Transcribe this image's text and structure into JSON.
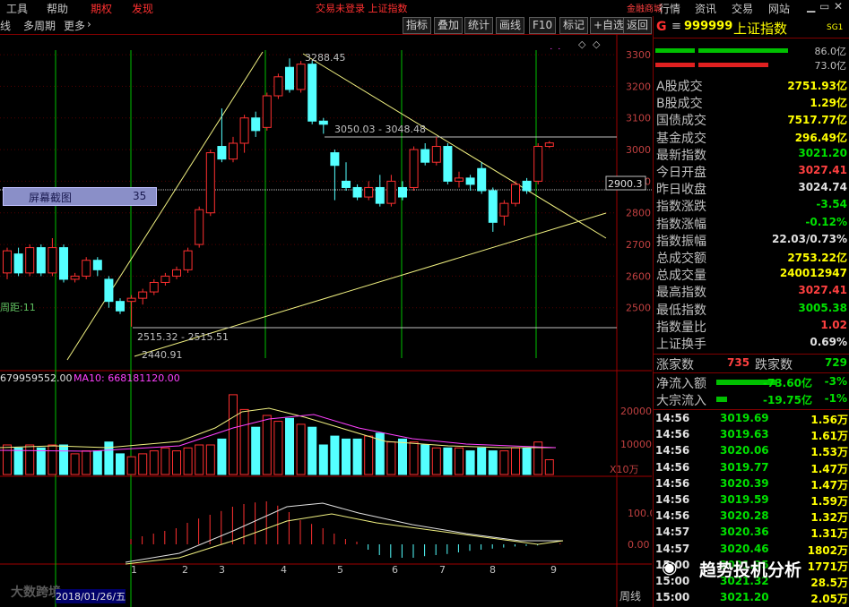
{
  "menu": {
    "tools": "工具",
    "help": "帮助",
    "futures": "期权",
    "publish": "发现",
    "status": "交易未登录  上证指数",
    "quote": "行情",
    "info": "资讯",
    "trade": "交易",
    "website": "网站",
    "finance_mall": "金融商城"
  },
  "toolbar": {
    "kline": "线",
    "multi_period": "多周期",
    "more": "更多",
    "indicator": "指标",
    "overlay": "叠加",
    "stats": "统计",
    "draw": "画线",
    "f10": "F10",
    "mark": "标记",
    "add_watch": "+自选",
    "back": "返回"
  },
  "stock": {
    "prefix": "G",
    "code": "999999",
    "name": "上证指数",
    "tag": "SG1",
    "bar1": "86.0亿",
    "bar2": "73.0亿"
  },
  "summary": [
    {
      "k": "A股成交",
      "v": "2751.93亿",
      "c": "#ffff00"
    },
    {
      "k": "B股成交",
      "v": "1.29亿",
      "c": "#ffff00"
    },
    {
      "k": "国债成交",
      "v": "7517.77亿",
      "c": "#ffff00"
    },
    {
      "k": "基金成交",
      "v": "296.49亿",
      "c": "#ffff00"
    },
    {
      "k": "最新指数",
      "v": "3021.20",
      "c": "#00e000"
    },
    {
      "k": "今日开盘",
      "v": "3027.41",
      "c": "#ff4040"
    },
    {
      "k": "昨日收盘",
      "v": "3024.74",
      "c": "#e0e0e0"
    },
    {
      "k": "指数涨跌",
      "v": "-3.54",
      "c": "#00e000"
    },
    {
      "k": "指数涨幅",
      "v": "-0.12%",
      "c": "#00e000"
    },
    {
      "k": "指数振幅",
      "v": "22.03/0.73%",
      "c": "#e0e0e0"
    },
    {
      "k": "总成交额",
      "v": "2753.22亿",
      "c": "#ffff00"
    },
    {
      "k": "总成交量",
      "v": "240012947",
      "c": "#ffff00"
    },
    {
      "k": "最高指数",
      "v": "3027.41",
      "c": "#ff4040"
    },
    {
      "k": "最低指数",
      "v": "3005.38",
      "c": "#00e000"
    },
    {
      "k": "指数量比",
      "v": "1.02",
      "c": "#ff4040"
    },
    {
      "k": "上证换手",
      "v": "0.69%",
      "c": "#e0e0e0"
    }
  ],
  "updown": {
    "up_label": "涨家数",
    "up": "735",
    "down_label": "跌家数",
    "down": "729"
  },
  "flows": [
    {
      "k": "净流入额",
      "v": "-73.60亿",
      "pct": "-3%"
    },
    {
      "k": "大宗流入",
      "v": "-19.75亿",
      "pct": "-1%"
    }
  ],
  "ticks": [
    {
      "t": "14:56",
      "p": "3019.69",
      "q": "1.56万"
    },
    {
      "t": "14:56",
      "p": "3019.63",
      "q": "1.61万"
    },
    {
      "t": "14:56",
      "p": "3020.06",
      "q": "1.53万"
    },
    {
      "t": "14:56",
      "p": "3019.77",
      "q": "1.47万"
    },
    {
      "t": "14:56",
      "p": "3020.39",
      "q": "1.47万"
    },
    {
      "t": "14:56",
      "p": "3019.59",
      "q": "1.59万"
    },
    {
      "t": "14:56",
      "p": "3020.28",
      "q": "1.32万"
    },
    {
      "t": "14:57",
      "p": "3020.36",
      "q": "1.31万"
    },
    {
      "t": "14:57",
      "p": "3020.46",
      "q": "1802万"
    },
    {
      "t": "15:00",
      "p": "3021.35",
      "q": "1771万"
    },
    {
      "t": "15:00",
      "p": "3021.32",
      "q": "28.5万"
    },
    {
      "t": "15:00",
      "p": "3021.20",
      "q": "2.05万"
    }
  ],
  "chart": {
    "price_ticks": [
      "3300",
      "3200",
      "3100",
      "3000",
      "2900",
      "2800",
      "2700",
      "2600",
      "2500"
    ],
    "current_price_tag": "2900.3",
    "annotations": {
      "high": "3288.45",
      "mid": "3050.03 - 3048.48",
      "low1": "2515.32 - 2515.51",
      "low2": "2440.91",
      "left": "周距:11"
    },
    "volume_ticks": [
      "20000",
      "10000"
    ],
    "volume_unit": "X10万",
    "volume_label": "679959552.00",
    "ma10_label": "MA10: 668181120.00",
    "macd_ticks": [
      "100.0",
      "0.00"
    ],
    "x_labels": [
      "1",
      "2",
      "3",
      "4",
      "5",
      "6",
      "7",
      "8",
      "9"
    ],
    "period_label": "周线",
    "screenshot_label": "屏幕截图",
    "screenshot_value": "35"
  },
  "watermark": {
    "brand": "趋势投机分析",
    "left": "大数跨境",
    "date": "2018/01/26/五"
  },
  "chart_data": {
    "type": "candlestick",
    "ylim": [
      2420,
      3320
    ],
    "candles": [
      {
        "o": 2610,
        "c": 2680,
        "h": 2690,
        "l": 2590
      },
      {
        "o": 2670,
        "c": 2610,
        "h": 2690,
        "l": 2600
      },
      {
        "o": 2610,
        "c": 2690,
        "h": 2700,
        "l": 2600
      },
      {
        "o": 2690,
        "c": 2610,
        "h": 2700,
        "l": 2600
      },
      {
        "o": 2610,
        "c": 2690,
        "h": 2720,
        "l": 2600
      },
      {
        "o": 2690,
        "c": 2590,
        "h": 2700,
        "l": 2580
      },
      {
        "o": 2590,
        "c": 2600,
        "h": 2610,
        "l": 2580
      },
      {
        "o": 2600,
        "c": 2650,
        "h": 2660,
        "l": 2590
      },
      {
        "o": 2650,
        "c": 2620,
        "h": 2660,
        "l": 2600
      },
      {
        "o": 2590,
        "c": 2520,
        "h": 2600,
        "l": 2500
      },
      {
        "o": 2520,
        "c": 2490,
        "h": 2530,
        "l": 2480
      },
      {
        "o": 2520,
        "c": 2530,
        "h": 2540,
        "l": 2440
      },
      {
        "o": 2530,
        "c": 2550,
        "h": 2560,
        "l": 2510
      },
      {
        "o": 2550,
        "c": 2580,
        "h": 2590,
        "l": 2540
      },
      {
        "o": 2580,
        "c": 2600,
        "h": 2610,
        "l": 2570
      },
      {
        "o": 2600,
        "c": 2620,
        "h": 2630,
        "l": 2590
      },
      {
        "o": 2620,
        "c": 2680,
        "h": 2690,
        "l": 2610
      },
      {
        "o": 2700,
        "c": 2810,
        "h": 2820,
        "l": 2690
      },
      {
        "o": 2800,
        "c": 2990,
        "h": 3000,
        "l": 2790
      },
      {
        "o": 3010,
        "c": 2970,
        "h": 3130,
        "l": 2960
      },
      {
        "o": 2970,
        "c": 3020,
        "h": 3040,
        "l": 2960
      },
      {
        "o": 3020,
        "c": 3100,
        "h": 3110,
        "l": 2990
      },
      {
        "o": 3100,
        "c": 3060,
        "h": 3120,
        "l": 3040
      },
      {
        "o": 3070,
        "c": 3170,
        "h": 3180,
        "l": 3060
      },
      {
        "o": 3170,
        "c": 3230,
        "h": 3240,
        "l": 3160
      },
      {
        "o": 3260,
        "c": 3190,
        "h": 3288,
        "l": 3180
      },
      {
        "o": 3190,
        "c": 3270,
        "h": 3280,
        "l": 3180
      },
      {
        "o": 3270,
        "c": 3090,
        "h": 3280,
        "l": 3080
      },
      {
        "o": 3090,
        "c": 3080,
        "h": 3100,
        "l": 3050
      },
      {
        "o": 2990,
        "c": 2950,
        "h": 3000,
        "l": 2840
      },
      {
        "o": 2900,
        "c": 2880,
        "h": 2960,
        "l": 2870
      },
      {
        "o": 2880,
        "c": 2850,
        "h": 2890,
        "l": 2840
      },
      {
        "o": 2850,
        "c": 2880,
        "h": 2900,
        "l": 2840
      },
      {
        "o": 2880,
        "c": 2830,
        "h": 2920,
        "l": 2820
      },
      {
        "o": 2830,
        "c": 2900,
        "h": 2920,
        "l": 2820
      },
      {
        "o": 2880,
        "c": 2850,
        "h": 2900,
        "l": 2840
      },
      {
        "o": 2880,
        "c": 3000,
        "h": 3010,
        "l": 2870
      },
      {
        "o": 3000,
        "c": 2960,
        "h": 3020,
        "l": 2950
      },
      {
        "o": 2960,
        "c": 3010,
        "h": 3040,
        "l": 2950
      },
      {
        "o": 3010,
        "c": 2900,
        "h": 3020,
        "l": 2890
      },
      {
        "o": 2900,
        "c": 2910,
        "h": 2930,
        "l": 2880
      },
      {
        "o": 2910,
        "c": 2890,
        "h": 2920,
        "l": 2870
      },
      {
        "o": 2940,
        "c": 2870,
        "h": 2960,
        "l": 2860
      },
      {
        "o": 2870,
        "c": 2770,
        "h": 2880,
        "l": 2740
      },
      {
        "o": 2790,
        "c": 2830,
        "h": 2840,
        "l": 2760
      },
      {
        "o": 2830,
        "c": 2890,
        "h": 2900,
        "l": 2820
      },
      {
        "o": 2900,
        "c": 2870,
        "h": 2910,
        "l": 2860
      },
      {
        "o": 2900,
        "c": 3010,
        "h": 3020,
        "l": 2890
      },
      {
        "o": 3010,
        "c": 3021,
        "h": 3027,
        "l": 3005
      }
    ],
    "volume": [
      10,
      9,
      10,
      9,
      10,
      10,
      7,
      8,
      8,
      11,
      7,
      6,
      7,
      8,
      9,
      8,
      9,
      10,
      10,
      12,
      27,
      22,
      16,
      20,
      18,
      19,
      17,
      16,
      10,
      13,
      12,
      12,
      13,
      14,
      11,
      12,
      11,
      10,
      9,
      9,
      9,
      8,
      9,
      8,
      8,
      9,
      9,
      11,
      5
    ],
    "macd": [
      10,
      15,
      20,
      25,
      30,
      40,
      48,
      55,
      62,
      70,
      75,
      78,
      80,
      72,
      60,
      45,
      38,
      30,
      20,
      10,
      5,
      -10,
      -20,
      -25,
      -25,
      -25,
      -22,
      -20,
      -18,
      -15,
      -12,
      -10,
      -8,
      -6,
      -4,
      -3,
      -2,
      0,
      2
    ],
    "xlabel": "",
    "ylabel": ""
  }
}
